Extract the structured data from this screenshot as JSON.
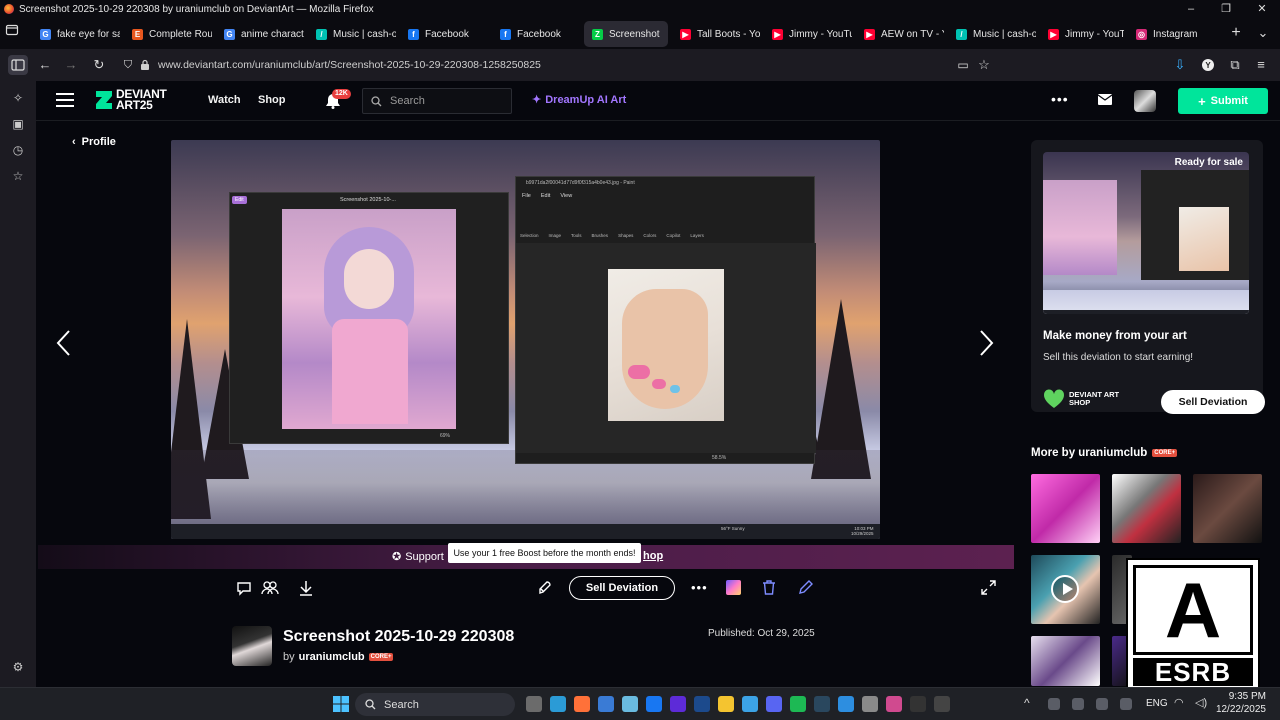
{
  "window": {
    "title": "Screenshot 2025-10-29 220308 by uraniumclub on DeviantArt — Mozilla Firefox",
    "min": "–",
    "max": "❐",
    "close": "✕"
  },
  "tabs": [
    {
      "label": "fake eye for sal",
      "color": "#4285f4",
      "glyph": "G"
    },
    {
      "label": "Complete Roun",
      "color": "#e8571e",
      "glyph": "E"
    },
    {
      "label": "anime characte",
      "color": "#4285f4",
      "glyph": "G"
    },
    {
      "label": "Music | cash-o",
      "color": "#00c2b2",
      "glyph": "/"
    },
    {
      "label": "Facebook",
      "color": "#1877f2",
      "glyph": "f"
    },
    {
      "label": "Facebook",
      "color": "#1877f2",
      "glyph": "f"
    },
    {
      "label": "Screenshot",
      "color": "#05cc47",
      "glyph": "Z",
      "active": true
    },
    {
      "label": "Tall Boots - You",
      "color": "#ff0033",
      "glyph": "▶"
    },
    {
      "label": "Jimmy - YouTu",
      "color": "#ff0033",
      "glyph": "▶"
    },
    {
      "label": "AEW on TV - Y",
      "color": "#ff0033",
      "glyph": "▶"
    },
    {
      "label": "Music | cash-o",
      "color": "#00c2b2",
      "glyph": "/"
    },
    {
      "label": "Jimmy - YouTu",
      "color": "#ff0033",
      "glyph": "▶"
    },
    {
      "label": "Instagram",
      "color": "#d62976",
      "glyph": "◎"
    }
  ],
  "nav": {
    "url": "www.deviantart.com/uraniumclub/art/Screenshot-2025-10-29-220308-1258250825"
  },
  "header": {
    "logo_line1": "DEVIANT",
    "logo_line2": "ART25",
    "watch": "Watch",
    "shop": "Shop",
    "notif_count": "12K",
    "search_placeholder": "Search",
    "dreamup": "DreamUp AI Art",
    "submit": "Submit"
  },
  "main": {
    "profile_link": "Profile",
    "support_text": "Support",
    "support_suffix": "hop",
    "tooltip": "Use your 1 free Boost before the month ends!",
    "sell_deviation": "Sell Deviation",
    "title": "Screenshot 2025-10-29 220308",
    "by": "by",
    "author": "uraniumclub",
    "core_badge": "CORE+",
    "published": "Published: Oct 29, 2025"
  },
  "screenshot_inner": {
    "left_window_title": "Screenshot 2025-10-...",
    "left_edit": "Edit",
    "left_zoom": "69%",
    "right_window_title": "b9971da2f00041d77d9f0f315a4b0e43.jpg - Paint",
    "menu": [
      "File",
      "Edit",
      "View"
    ],
    "tools": [
      "Selection",
      "Image",
      "Tools",
      "Brushes",
      "Shapes",
      "Colors",
      "Copilot",
      "Layers"
    ],
    "right_zoom": "58.5%",
    "time": "10:03 PM",
    "date": "10/29/2025",
    "weather": "56°F Sunny"
  },
  "rightpanel": {
    "ready": "Ready for sale",
    "make_money": "Make money from your art",
    "sell_this": "Sell this deviation to start earning!",
    "shop_logo_1": "DEVIANT ART",
    "shop_logo_2": "SHOP",
    "sell_btn": "Sell Deviation",
    "more_by": "More by uraniumclub",
    "core_badge": "CORE+"
  },
  "esrb": {
    "letter": "A",
    "label": "ESRB"
  },
  "taskbar": {
    "search": "Search",
    "lang": "ENG",
    "time": "9:35 PM",
    "date": "12/22/2025"
  },
  "colors": {
    "accent_green": "#00e59b",
    "dreamup_purple": "#a276ff",
    "core_badge": "#e3503e"
  }
}
